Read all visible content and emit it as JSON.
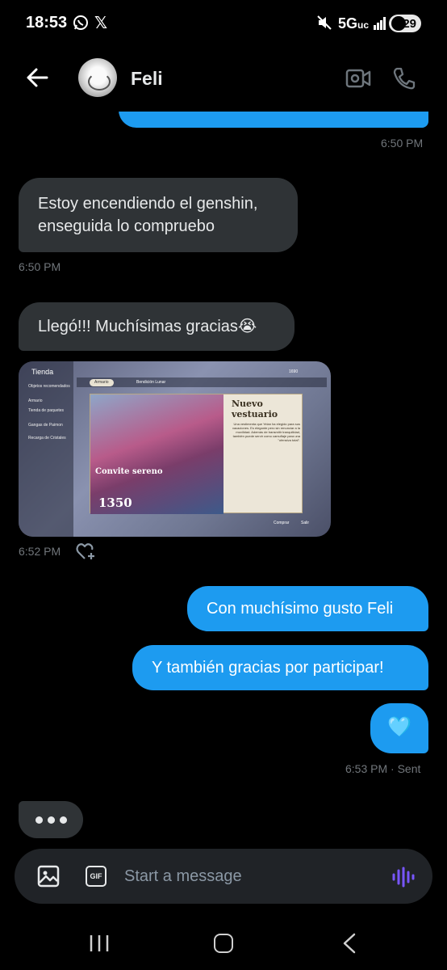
{
  "status_bar": {
    "time": "18:53",
    "network": "5G",
    "network_sub": "uc",
    "battery": "29"
  },
  "header": {
    "contact_name": "Feli"
  },
  "messages": {
    "ts_1": "6:50 PM",
    "recv_1": "Estoy encendiendo el genshin, enseguida lo compruebo",
    "ts_2": "6:50 PM",
    "recv_2": "Llegó!!! Muchísimas gracias😭",
    "image": {
      "shop_title": "Tienda",
      "menu": [
        "Objetos recomendados",
        "Armario",
        "Tienda de paquetes",
        "Gangas de Paimon",
        "Recarga de Cristales"
      ],
      "tabs": [
        "Armario",
        "Bendición Lunar"
      ],
      "currency": "1690",
      "card_title": "Nuevo vestuario",
      "outfit_name": "Convite sereno",
      "outfit_desc": "Una vestimenta que Yelan ha elegido para sus vacaciones. Es elegante pero sin renunciar a la movilidad. Además de transmitir tranquilidad, también puede servir como camuflaje para una \"ofensiva total\".",
      "price": "1350",
      "buy": "Comprar",
      "exit": "Salir"
    },
    "ts_3": "6:52 PM",
    "sent_1": "Con muchísimo gusto Feli",
    "sent_2": "Y también gracias por participar!",
    "sent_3": "🩵",
    "ts_4": "6:53 PM · Sent"
  },
  "composer": {
    "placeholder": "Start a message"
  },
  "colors": {
    "accent": "#1d9bf0",
    "received_bubble": "#2f3336",
    "voice": "#7856ff"
  }
}
